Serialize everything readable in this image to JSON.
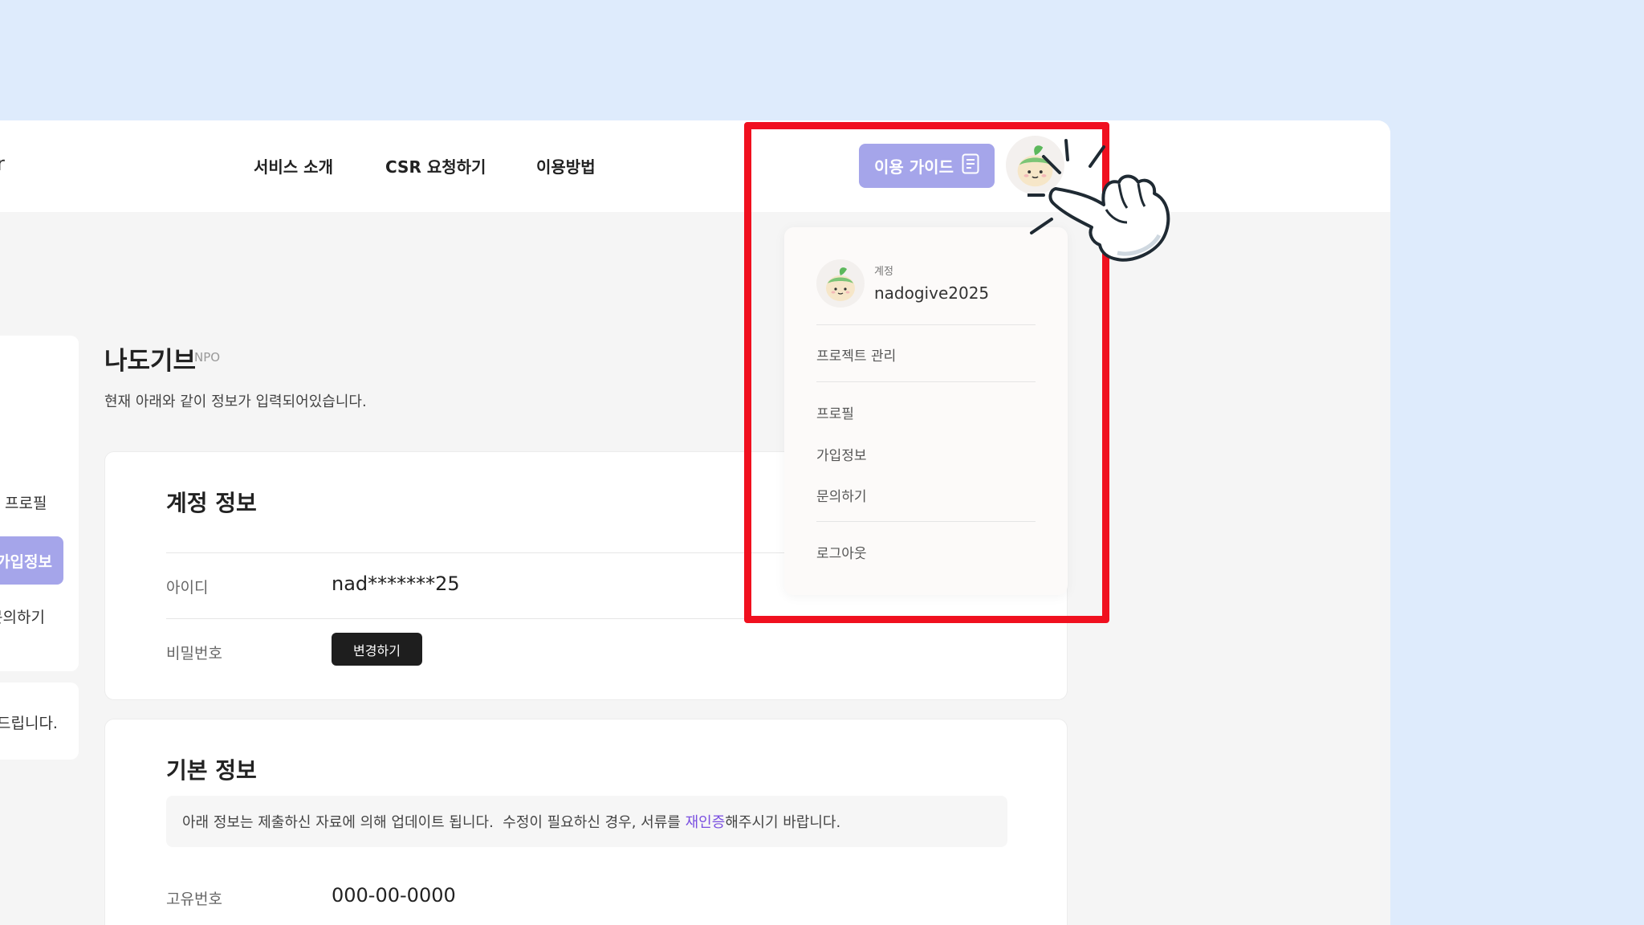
{
  "header": {
    "logo_fragment": "r",
    "nav": [
      "서비스 소개",
      "CSR 요청하기",
      "이용방법"
    ],
    "guide_button": "이용 가이드"
  },
  "sidebar": {
    "items": [
      "프로필",
      "가입정보",
      "문의하기"
    ],
    "active_index": 1,
    "footer_text": "드립니다."
  },
  "org": {
    "name": "나도기브",
    "tag": "NPO",
    "subtitle": "현재 아래와 같이 정보가 입력되어있습니다."
  },
  "account_info": {
    "title": "계정 정보",
    "id_label": "아이디",
    "id_value": "nad*******25",
    "password_label": "비밀번호",
    "change_button": "변경하기"
  },
  "basic_info": {
    "title": "기본 정보",
    "notice_before": "아래 정보는 제출하신 자료에 의해 업데이트 됩니다.  수정이 필요하신 경우, 서류를 ",
    "notice_link": "재인증",
    "notice_after": "해주시기 바랍니다.",
    "id_number_label": "고유번호",
    "id_number_value": "000-00-0000"
  },
  "dropdown": {
    "account_label": "계정",
    "username": "nadogive2025",
    "project_manage": "프로젝트 관리",
    "items": [
      "프로필",
      "가입정보",
      "문의하기"
    ],
    "logout": "로그아웃"
  },
  "colors": {
    "background": "#deebfc",
    "accent": "#a5a5ea",
    "highlight": "#f0101f",
    "link": "#7a4fe0"
  }
}
